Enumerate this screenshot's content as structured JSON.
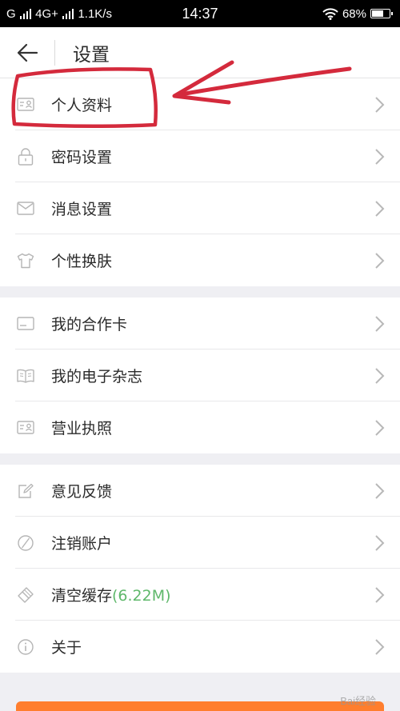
{
  "status_bar": {
    "carrier_left": "G",
    "network": "4G+",
    "speed": "1.1K/s",
    "time": "14:37",
    "battery": "68%",
    "battery_level": 0.68
  },
  "header": {
    "back_icon": "arrow-left-icon",
    "title": "设置"
  },
  "groups": [
    {
      "items": [
        {
          "label": "个人资料",
          "icon": "profile-card-icon"
        },
        {
          "label": "密码设置",
          "icon": "lock-icon"
        },
        {
          "label": "消息设置",
          "icon": "envelope-icon"
        },
        {
          "label": "个性换肤",
          "icon": "shirt-icon"
        }
      ]
    },
    {
      "items": [
        {
          "label": "我的合作卡",
          "icon": "card-icon"
        },
        {
          "label": "我的电子杂志",
          "icon": "book-icon"
        },
        {
          "label": "营业执照",
          "icon": "license-card-icon"
        }
      ]
    },
    {
      "items": [
        {
          "label": "意见反馈",
          "icon": "edit-icon"
        },
        {
          "label": "注销账户",
          "icon": "prohibit-icon"
        },
        {
          "label": "清空缓存",
          "extra": "(6.22M)",
          "icon": "eraser-icon"
        },
        {
          "label": "关于",
          "icon": "info-icon"
        }
      ]
    }
  ],
  "colors": {
    "accent_green": "#5fb86b",
    "annotation_red": "#d42a3c",
    "bottom_button": "#ff7e2e"
  },
  "watermark": "Bai经验"
}
